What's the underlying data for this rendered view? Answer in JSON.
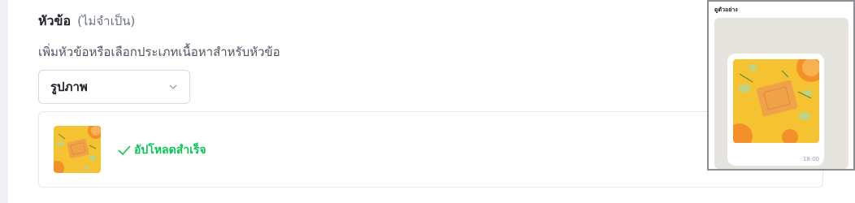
{
  "header": {
    "title": "หัวข้อ",
    "optional": "(ไม่จำเป็น)",
    "subtitle": "เพิ่มหัวข้อหรือเลือกประเภทเนื้อหาสำหรับหัวข้อ"
  },
  "type_select": {
    "value": "รูปภาพ"
  },
  "upload": {
    "status": "อัปโหลดสำเร็จ"
  },
  "preview": {
    "label": "ดูตัวอย่าง",
    "time": "18:00"
  },
  "colors": {
    "success": "#06c755",
    "image_bg": "#f5c231"
  }
}
